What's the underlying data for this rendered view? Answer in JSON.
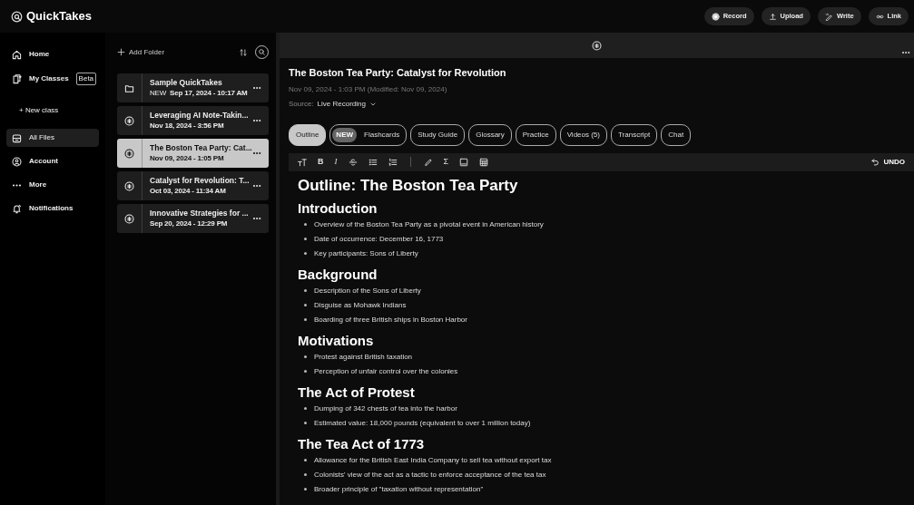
{
  "app": {
    "logo": "QuickTakes"
  },
  "top_actions": [
    {
      "kind": "record",
      "label": "Record"
    },
    {
      "kind": "upload",
      "label": "Upload"
    },
    {
      "kind": "write",
      "label": "Write"
    },
    {
      "kind": "link",
      "label": "Link"
    }
  ],
  "sidebar": {
    "items": [
      {
        "kind": "home",
        "label": "Home",
        "selected": false
      },
      {
        "kind": "classes",
        "label": "My Classes",
        "badge": "Beta",
        "selected": false
      },
      {
        "kind": "sub",
        "label": "+ New class",
        "selected": false
      },
      {
        "kind": "files",
        "label": "All Files",
        "selected": true
      },
      {
        "kind": "account",
        "label": "Account",
        "selected": false
      },
      {
        "kind": "more",
        "label": "More",
        "selected": false
      },
      {
        "kind": "bell",
        "label": "Notifications",
        "selected": false
      }
    ]
  },
  "folder_panel": {
    "add_folder": "Add Folder",
    "files": [
      {
        "kind": "folder",
        "title": "Sample QuickTakes",
        "tag": "NEW",
        "date": "Sep 17, 2024 - 10:17 AM",
        "selected": false
      },
      {
        "kind": "recording",
        "title": "Leveraging AI Note-Takin...",
        "date": "Nov 18, 2024 - 3:56 PM",
        "selected": false
      },
      {
        "kind": "recording",
        "title": "The Boston Tea Party: Cat...",
        "date": "Nov 09, 2024 - 1:05 PM",
        "selected": true
      },
      {
        "kind": "recording",
        "title": "Catalyst for Revolution: T...",
        "date": "Oct 03, 2024 - 11:34 AM",
        "selected": false
      },
      {
        "kind": "recording",
        "title": "Innovative Strategies for ...",
        "date": "Sep 20, 2024 - 12:29 PM",
        "selected": false
      }
    ]
  },
  "document": {
    "title": "The Boston Tea Party: Catalyst for Revolution",
    "meta": "Nov 09, 2024 - 1:03 PM (Modified: Nov 09, 2024)",
    "source_label": "Source:",
    "source_value": "Live Recording",
    "tabs": [
      {
        "label": "Outline",
        "selected": true
      },
      {
        "label": "Flashcards",
        "badge": "NEW",
        "selected": false
      },
      {
        "label": "Study Guide",
        "selected": false
      },
      {
        "label": "Glossary",
        "selected": false
      },
      {
        "label": "Practice",
        "selected": false
      },
      {
        "label": "Videos (5)",
        "selected": false
      },
      {
        "label": "Transcript",
        "selected": false
      },
      {
        "label": "Chat",
        "selected": false
      }
    ],
    "toolbar": [
      {
        "kind": "text-size"
      },
      {
        "kind": "bold",
        "text": "B"
      },
      {
        "kind": "italic",
        "text": "I"
      },
      {
        "kind": "strike"
      },
      {
        "kind": "bullets"
      },
      {
        "kind": "numbers"
      },
      {
        "kind": "divider"
      },
      {
        "kind": "pen"
      },
      {
        "kind": "sigma",
        "text": "Σ"
      },
      {
        "kind": "image"
      },
      {
        "kind": "table"
      }
    ],
    "undo": "UNDO",
    "outline_title": "Outline: The Boston Tea Party",
    "sections": [
      {
        "heading": "Introduction",
        "bullets": [
          "Overview of the Boston Tea Party as a pivotal event in American history",
          "Date of occurrence: December 16, 1773",
          "Key participants: Sons of Liberty"
        ]
      },
      {
        "heading": "Background",
        "bullets": [
          "Description of the Sons of Liberty",
          "Disguise as Mohawk Indians",
          "Boarding of three British ships in Boston Harbor"
        ]
      },
      {
        "heading": "Motivations",
        "bullets": [
          "Protest against British taxation",
          "Perception of unfair control over the colonies"
        ]
      },
      {
        "heading": "The Act of Protest",
        "bullets": [
          "Dumping of 342 chests of tea into the harbor",
          "Estimated value: 18,000 pounds (equivalent to over 1 million today)"
        ]
      },
      {
        "heading": "The Tea Act of 1773",
        "bullets": [
          "Allowance for the British East India Company to sell tea without export tax",
          "Colonists' view of the act as a tactic to enforce acceptance of the tea tax",
          "Broader principle of \"taxation without representation\""
        ]
      }
    ]
  }
}
